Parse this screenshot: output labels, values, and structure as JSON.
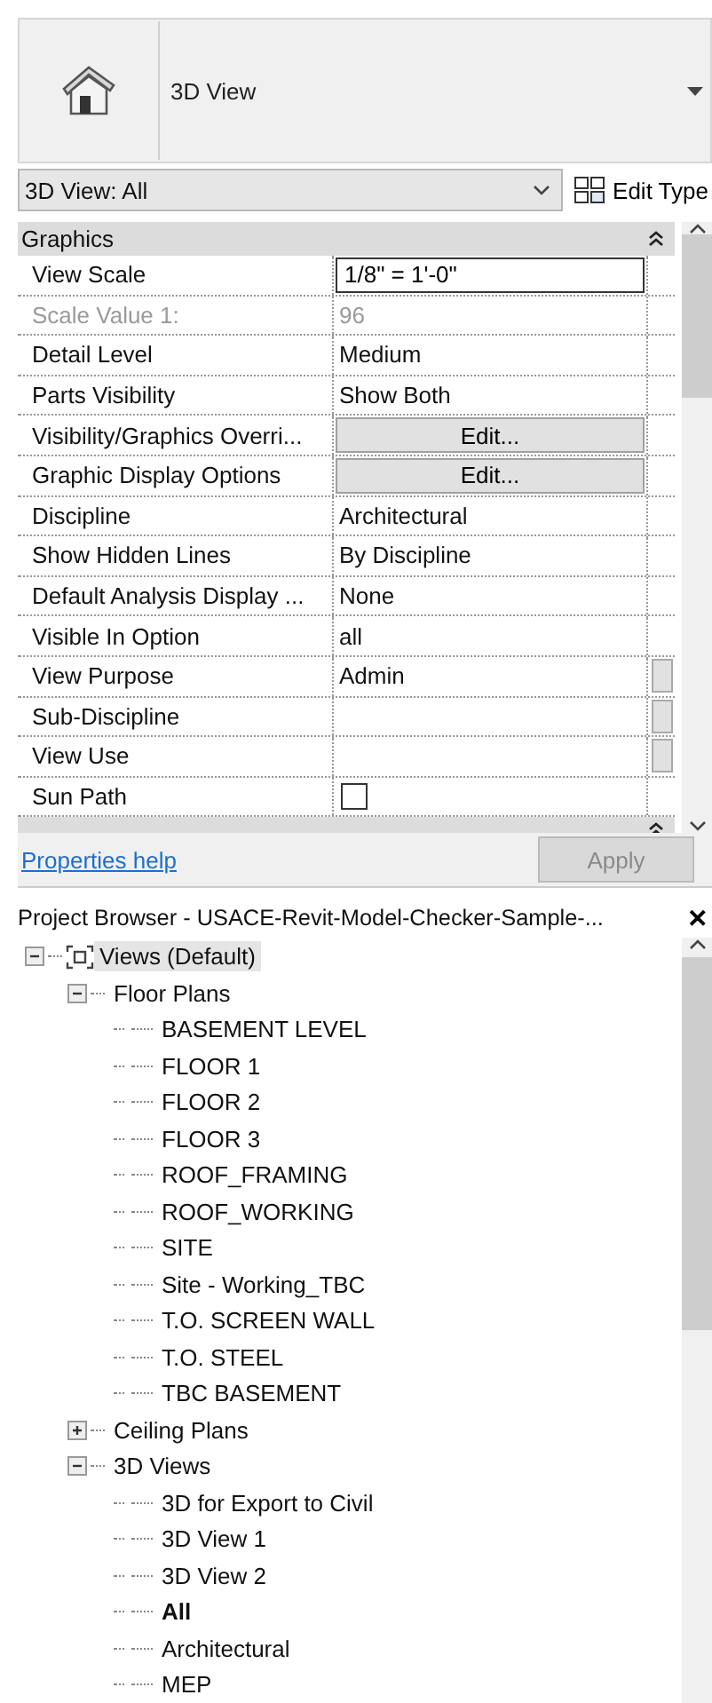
{
  "type_selector": {
    "label": "3D View"
  },
  "instance_dropdown": {
    "value": "3D View: All"
  },
  "edit_type_button": {
    "label": "Edit Type"
  },
  "properties": {
    "group": {
      "label": "Graphics",
      "expanded": true
    },
    "rows": [
      {
        "name": "View Scale",
        "value": "1/8\" = 1'-0\"",
        "kind": "input",
        "disabled": false,
        "browse": false
      },
      {
        "name": "Scale Value    1:",
        "value": "96",
        "kind": "text",
        "disabled": true,
        "browse": false
      },
      {
        "name": "Detail Level",
        "value": "Medium",
        "kind": "text",
        "disabled": false,
        "browse": false
      },
      {
        "name": "Parts Visibility",
        "value": "Show Both",
        "kind": "text",
        "disabled": false,
        "browse": false
      },
      {
        "name": "Visibility/Graphics Overri...",
        "value": "Edit...",
        "kind": "button",
        "disabled": false,
        "browse": false
      },
      {
        "name": "Graphic Display Options",
        "value": "Edit...",
        "kind": "button",
        "disabled": false,
        "browse": false
      },
      {
        "name": "Discipline",
        "value": "Architectural",
        "kind": "text",
        "disabled": false,
        "browse": false
      },
      {
        "name": "Show Hidden Lines",
        "value": "By Discipline",
        "kind": "text",
        "disabled": false,
        "browse": false
      },
      {
        "name": "Default Analysis Display ...",
        "value": "None",
        "kind": "text",
        "disabled": false,
        "browse": false
      },
      {
        "name": "Visible In Option",
        "value": "all",
        "kind": "text",
        "disabled": false,
        "browse": false
      },
      {
        "name": "View Purpose",
        "value": "Admin",
        "kind": "text",
        "disabled": false,
        "browse": true
      },
      {
        "name": "Sub-Discipline",
        "value": "",
        "kind": "text",
        "disabled": false,
        "browse": true
      },
      {
        "name": "View Use",
        "value": "",
        "kind": "text",
        "disabled": false,
        "browse": true
      },
      {
        "name": "Sun Path",
        "checked": false,
        "kind": "checkbox",
        "disabled": false,
        "browse": false
      }
    ],
    "next_group": {
      "expanded": true
    }
  },
  "help_link": "Properties help",
  "apply_button": {
    "label": "Apply",
    "disabled": true
  },
  "project_browser": {
    "title": "Project Browser - USACE-Revit-Model-Checker-Sample-...",
    "close": "✕",
    "tree": [
      {
        "label": "Views (Default)",
        "expanded": true,
        "selected": true,
        "current": false,
        "children": [
          {
            "label": "Floor Plans",
            "expanded": true,
            "selected": false,
            "current": false,
            "children": [
              {
                "label": "BASEMENT LEVEL",
                "selected": false,
                "current": false
              },
              {
                "label": "FLOOR 1",
                "selected": false,
                "current": false
              },
              {
                "label": "FLOOR 2",
                "selected": false,
                "current": false
              },
              {
                "label": "FLOOR 3",
                "selected": false,
                "current": false
              },
              {
                "label": "ROOF_FRAMING",
                "selected": false,
                "current": false
              },
              {
                "label": "ROOF_WORKING",
                "selected": false,
                "current": false
              },
              {
                "label": "SITE",
                "selected": false,
                "current": false
              },
              {
                "label": "Site - Working_TBC",
                "selected": false,
                "current": false
              },
              {
                "label": "T.O. SCREEN WALL",
                "selected": false,
                "current": false
              },
              {
                "label": "T.O. STEEL",
                "selected": false,
                "current": false
              },
              {
                "label": "TBC BASEMENT",
                "selected": false,
                "current": false
              }
            ]
          },
          {
            "label": "Ceiling Plans",
            "expanded": false,
            "selected": false,
            "current": false
          },
          {
            "label": "3D Views",
            "expanded": true,
            "selected": false,
            "current": false,
            "children": [
              {
                "label": "3D for Export to Civil",
                "selected": false,
                "current": false
              },
              {
                "label": "3D View 1",
                "selected": false,
                "current": false
              },
              {
                "label": "3D View 2",
                "selected": false,
                "current": false
              },
              {
                "label": "All",
                "selected": false,
                "current": true
              },
              {
                "label": "Architectural",
                "selected": false,
                "current": false
              },
              {
                "label": "MEP",
                "selected": false,
                "current": false
              }
            ]
          }
        ]
      }
    ]
  }
}
